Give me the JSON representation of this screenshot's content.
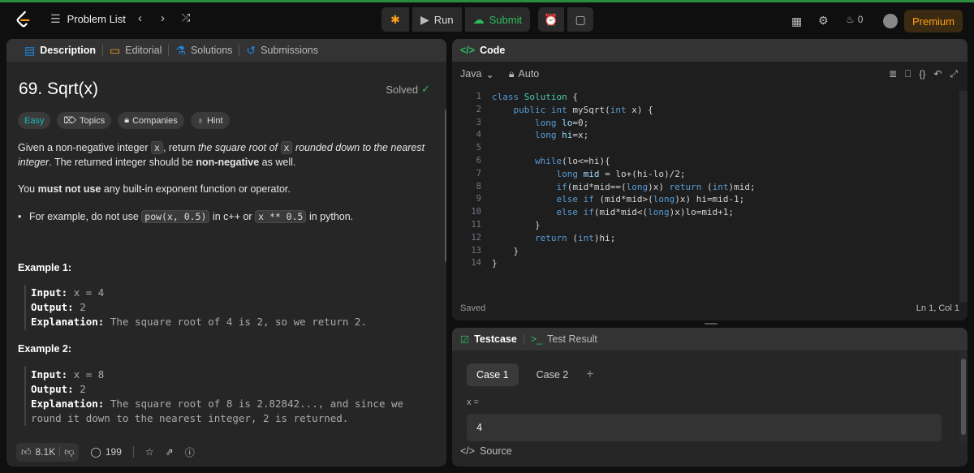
{
  "topbar": {
    "problem_list": "Problem List",
    "run": "Run",
    "submit": "Submit",
    "coins": "0",
    "premium": "Premium"
  },
  "left_tabs": [
    {
      "label": "Description",
      "active": true
    },
    {
      "label": "Editorial"
    },
    {
      "label": "Solutions"
    },
    {
      "label": "Submissions"
    }
  ],
  "problem": {
    "title": "69. Sqrt(x)",
    "solved": "Solved",
    "difficulty": "Easy",
    "topics": "Topics",
    "companies": "Companies",
    "hint": "Hint",
    "desc1_a": "Given a non-negative integer",
    "desc1_x": "x",
    "desc1_b": ", return",
    "desc1_c": "the square root of",
    "desc1_x2": "x",
    "desc1_d": "rounded down to the nearest integer",
    "desc1_e": ". The returned integer should be",
    "desc1_f": "non-negative",
    "desc1_g": "as well.",
    "desc2_a": "You",
    "desc2_b": "must not use",
    "desc2_c": "any built-in exponent function or operator.",
    "desc3_a": "For example, do not use",
    "desc3_code1": "pow(x, 0.5)",
    "desc3_b": "in c++ or",
    "desc3_code2": "x ** 0.5",
    "desc3_c": "in python.",
    "examples": [
      {
        "heading": "Example 1:",
        "input_label": "Input:",
        "input": "x = 4",
        "output_label": "Output:",
        "output": "2",
        "expl_label": "Explanation:",
        "expl1": "The square root of 4 is 2, so we return 2.",
        "expl2": ""
      },
      {
        "heading": "Example 2:",
        "input_label": "Input:",
        "input": "x = 8",
        "output_label": "Output:",
        "output": "2",
        "expl_label": "Explanation:",
        "expl1": "The square root of 8 is 2.82842..., and since we",
        "expl2": "round it down to the nearest integer, 2 is returned."
      }
    ],
    "likes": "8.1K",
    "comments": "199"
  },
  "code_panel": {
    "title": "Code",
    "language": "Java",
    "auto": "Auto",
    "saved": "Saved",
    "cursor": "Ln 1, Col 1",
    "line_numbers": [
      "1",
      "2",
      "3",
      "4",
      "5",
      "6",
      "7",
      "8",
      "9",
      "10",
      "11",
      "12",
      "13",
      "14"
    ]
  },
  "test_panel": {
    "testcase": "Testcase",
    "test_result": "Test Result",
    "case1": "Case 1",
    "case2": "Case 2",
    "plus": "+",
    "var_label": "x =",
    "var_value": "4",
    "source": "Source"
  }
}
